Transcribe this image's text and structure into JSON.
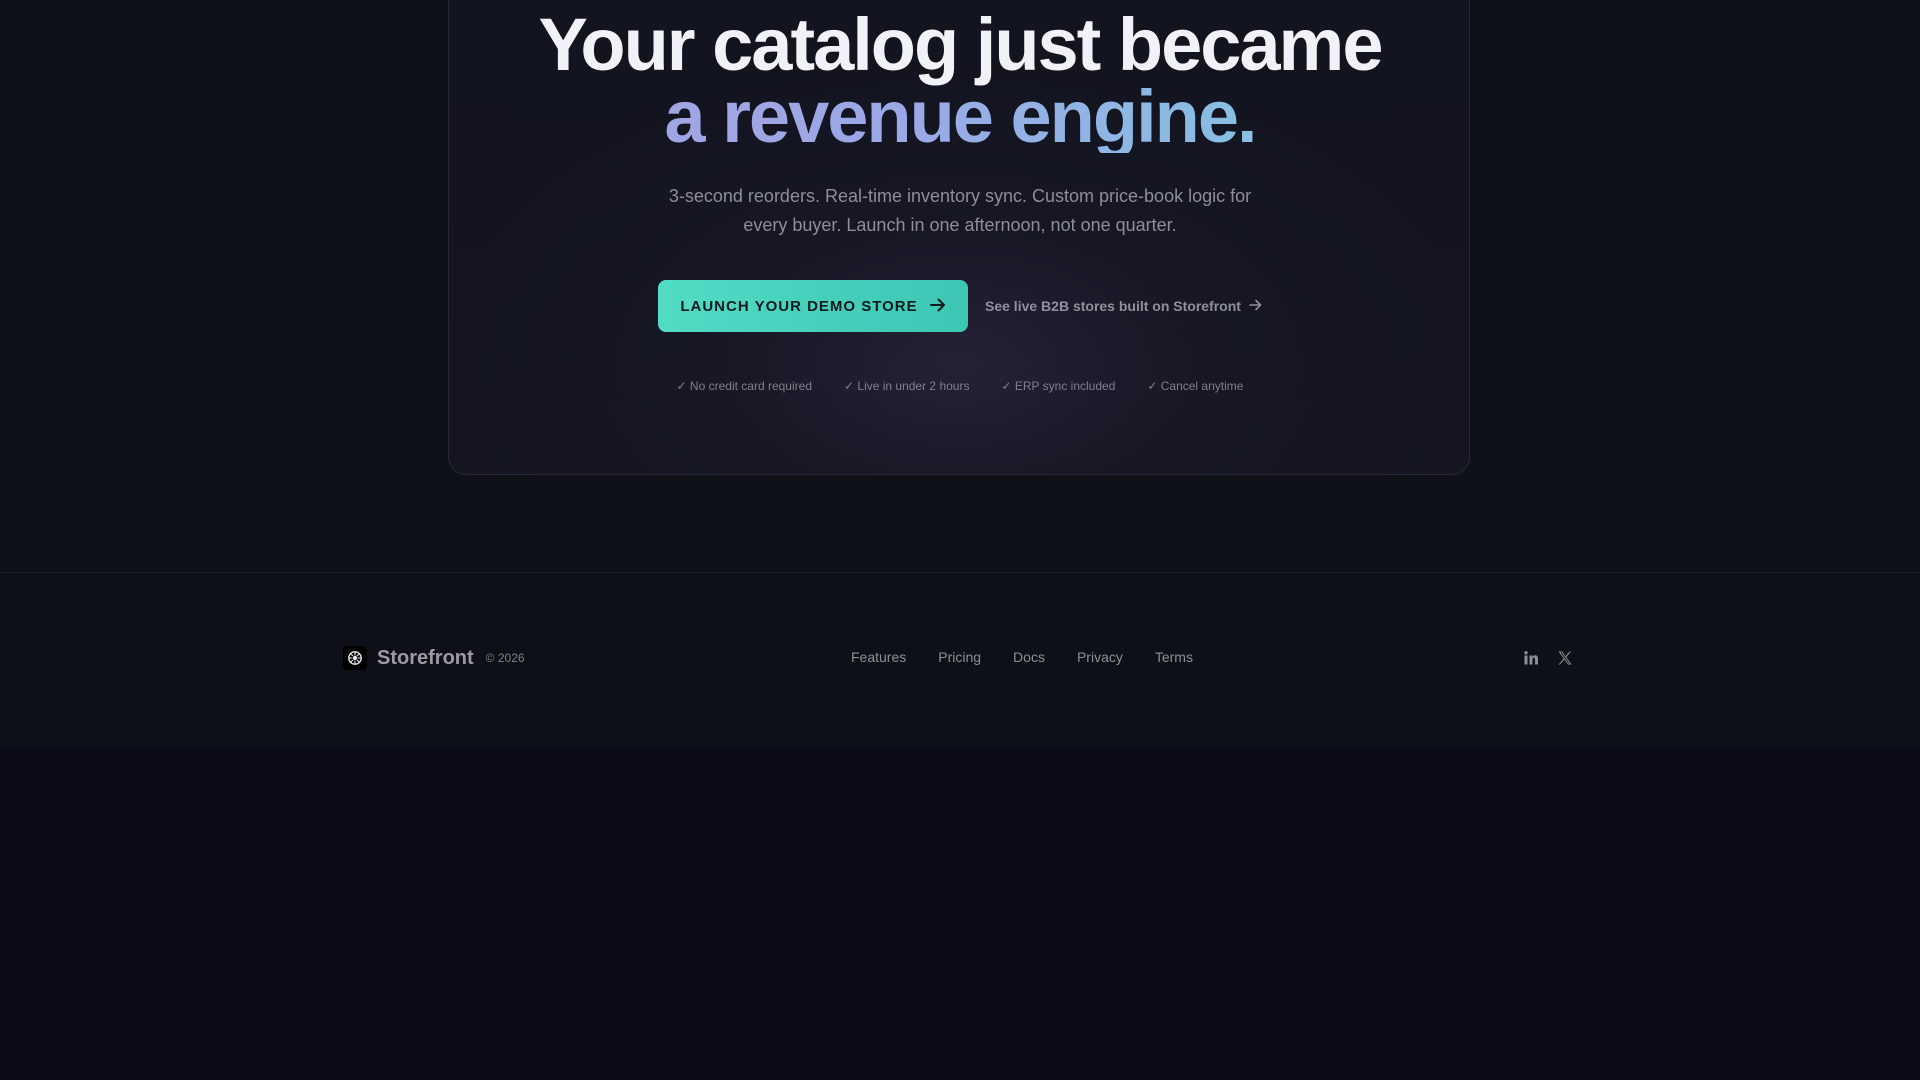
{
  "hero": {
    "headline_line1": "Your catalog just became",
    "headline_line2": "a revenue engine.",
    "subtitle": "3-second reorders. Real-time inventory sync. Custom price-book logic for every buyer. Launch in one afternoon, not one quarter.",
    "primary_cta": "LAUNCH YOUR DEMO STORE",
    "primary_cta_icon": "arrow-right-icon",
    "secondary_cta": "See live B2B stores built on Storefront",
    "secondary_cta_icon": "arrow-right-icon",
    "perks": [
      "✓ No credit card required",
      "✓ Live in under 2 hours",
      "✓ ERP sync included",
      "✓ Cancel anytime"
    ]
  },
  "footer": {
    "brand_name": "Storefront",
    "copyright": "© 2026",
    "logo_icon": "storefront-logo-icon",
    "nav": [
      "Features",
      "Pricing",
      "Docs",
      "Privacy",
      "Terms"
    ],
    "socials": [
      "linkedin-icon",
      "x-icon"
    ]
  },
  "colors": {
    "accent": "#4fd8c1",
    "gradient_text_start": "#a6a2e0",
    "gradient_text_end": "#7ccde0",
    "background": "#0a0a18"
  }
}
